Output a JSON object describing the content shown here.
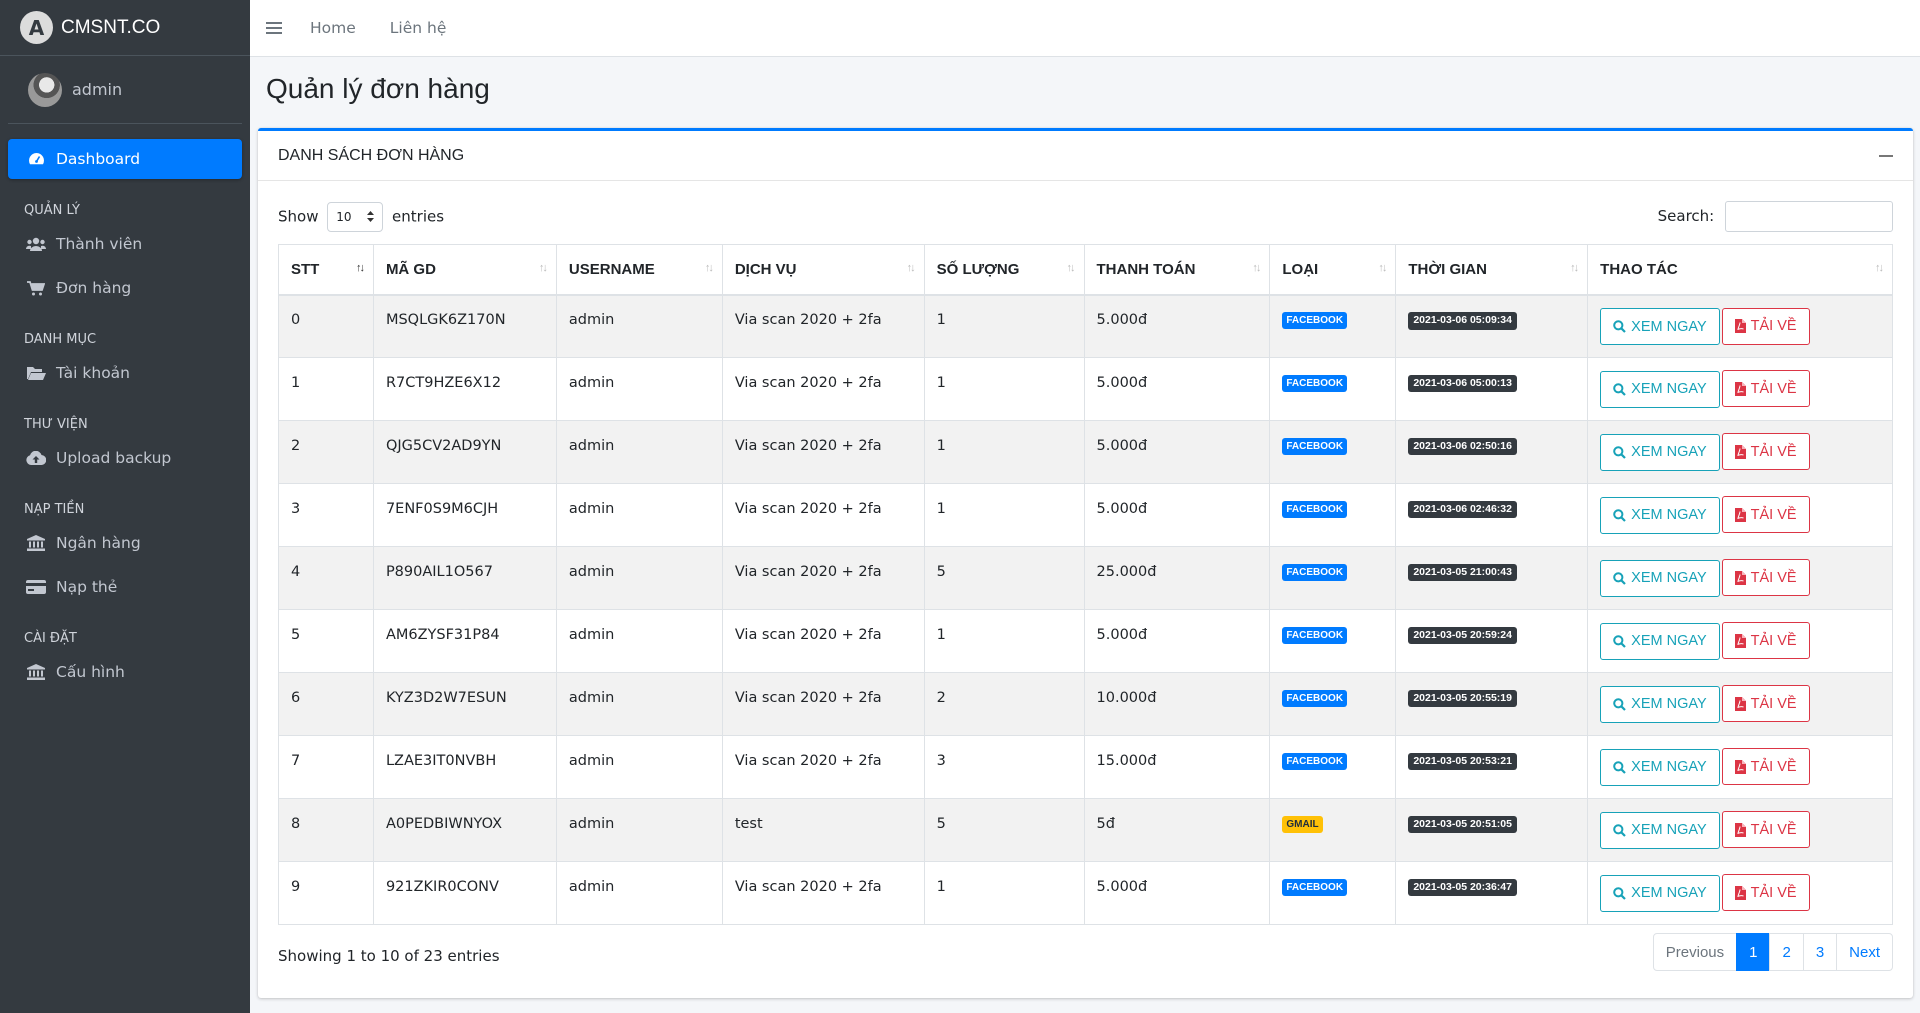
{
  "brand": {
    "name": "CMSNT.CO"
  },
  "user": {
    "name": "admin"
  },
  "sidebar": {
    "dashboard": "Dashboard",
    "sections": [
      {
        "header": "QUẢN LÝ",
        "items": [
          "Thành viên",
          "Đơn hàng"
        ]
      },
      {
        "header": "DANH MỤC",
        "items": [
          "Tài khoản"
        ]
      },
      {
        "header": "THƯ VIỆN",
        "items": [
          "Upload backup"
        ]
      },
      {
        "header": "NẠP TIỀN",
        "items": [
          "Ngân hàng",
          "Nạp thẻ"
        ]
      },
      {
        "header": "CÀI ĐẶT",
        "items": [
          "Cấu hình"
        ]
      }
    ]
  },
  "topnav": {
    "home": "Home",
    "contact": "Liên hệ"
  },
  "page": {
    "title": "Quản lý đơn hàng"
  },
  "card": {
    "title": "DANH SÁCH ĐƠN HÀNG"
  },
  "controls": {
    "show_label": "Show",
    "entries_value": "10",
    "entries_label": "entries",
    "search_label": "Search:",
    "search_value": ""
  },
  "table": {
    "headers": [
      "STT",
      "MÃ GD",
      "USERNAME",
      "DỊCH VỤ",
      "SỐ LƯỢNG",
      "THANH TOÁN",
      "LOẠI",
      "THỜI GIAN",
      "THAO TÁC"
    ],
    "rows": [
      {
        "stt": "0",
        "code": "MSQLGK6Z170N",
        "username": "admin",
        "service": "Via scan 2020 + 2fa",
        "qty": "1",
        "payment": "5.000đ",
        "type": "FACEBOOK",
        "time": "2021-03-06 05:09:34"
      },
      {
        "stt": "1",
        "code": "R7CT9HZE6X12",
        "username": "admin",
        "service": "Via scan 2020 + 2fa",
        "qty": "1",
        "payment": "5.000đ",
        "type": "FACEBOOK",
        "time": "2021-03-06 05:00:13"
      },
      {
        "stt": "2",
        "code": "QJG5CV2AD9YN",
        "username": "admin",
        "service": "Via scan 2020 + 2fa",
        "qty": "1",
        "payment": "5.000đ",
        "type": "FACEBOOK",
        "time": "2021-03-06 02:50:16"
      },
      {
        "stt": "3",
        "code": "7ENF0S9M6CJH",
        "username": "admin",
        "service": "Via scan 2020 + 2fa",
        "qty": "1",
        "payment": "5.000đ",
        "type": "FACEBOOK",
        "time": "2021-03-06 02:46:32"
      },
      {
        "stt": "4",
        "code": "P890AIL1O567",
        "username": "admin",
        "service": "Via scan 2020 + 2fa",
        "qty": "5",
        "payment": "25.000đ",
        "type": "FACEBOOK",
        "time": "2021-03-05 21:00:43"
      },
      {
        "stt": "5",
        "code": "AM6ZYSF31P84",
        "username": "admin",
        "service": "Via scan 2020 + 2fa",
        "qty": "1",
        "payment": "5.000đ",
        "type": "FACEBOOK",
        "time": "2021-03-05 20:59:24"
      },
      {
        "stt": "6",
        "code": "KYZ3D2W7ESUN",
        "username": "admin",
        "service": "Via scan 2020 + 2fa",
        "qty": "2",
        "payment": "10.000đ",
        "type": "FACEBOOK",
        "time": "2021-03-05 20:55:19"
      },
      {
        "stt": "7",
        "code": "LZAE3IT0NVBH",
        "username": "admin",
        "service": "Via scan 2020 + 2fa",
        "qty": "3",
        "payment": "15.000đ",
        "type": "FACEBOOK",
        "time": "2021-03-05 20:53:21"
      },
      {
        "stt": "8",
        "code": "A0PEDBIWNYOX",
        "username": "admin",
        "service": "test",
        "qty": "5",
        "payment": "5đ",
        "type": "GMAIL",
        "time": "2021-03-05 20:51:05"
      },
      {
        "stt": "9",
        "code": "921ZKIR0CONV",
        "username": "admin",
        "service": "Via scan 2020 + 2fa",
        "qty": "1",
        "payment": "5.000đ",
        "type": "FACEBOOK",
        "time": "2021-03-05 20:36:47"
      }
    ],
    "actions": {
      "view": "XEM NGAY",
      "download": "TẢI VỀ"
    }
  },
  "footer": {
    "info": "Showing 1 to 10 of 23 entries"
  },
  "pagination": {
    "previous": "Previous",
    "pages": [
      "1",
      "2",
      "3"
    ],
    "next": "Next",
    "current": "1"
  },
  "colors": {
    "primary": "#007bff",
    "sidebar": "#343a40",
    "info": "#17a2b8",
    "danger": "#dc3545",
    "warning": "#ffc107"
  }
}
